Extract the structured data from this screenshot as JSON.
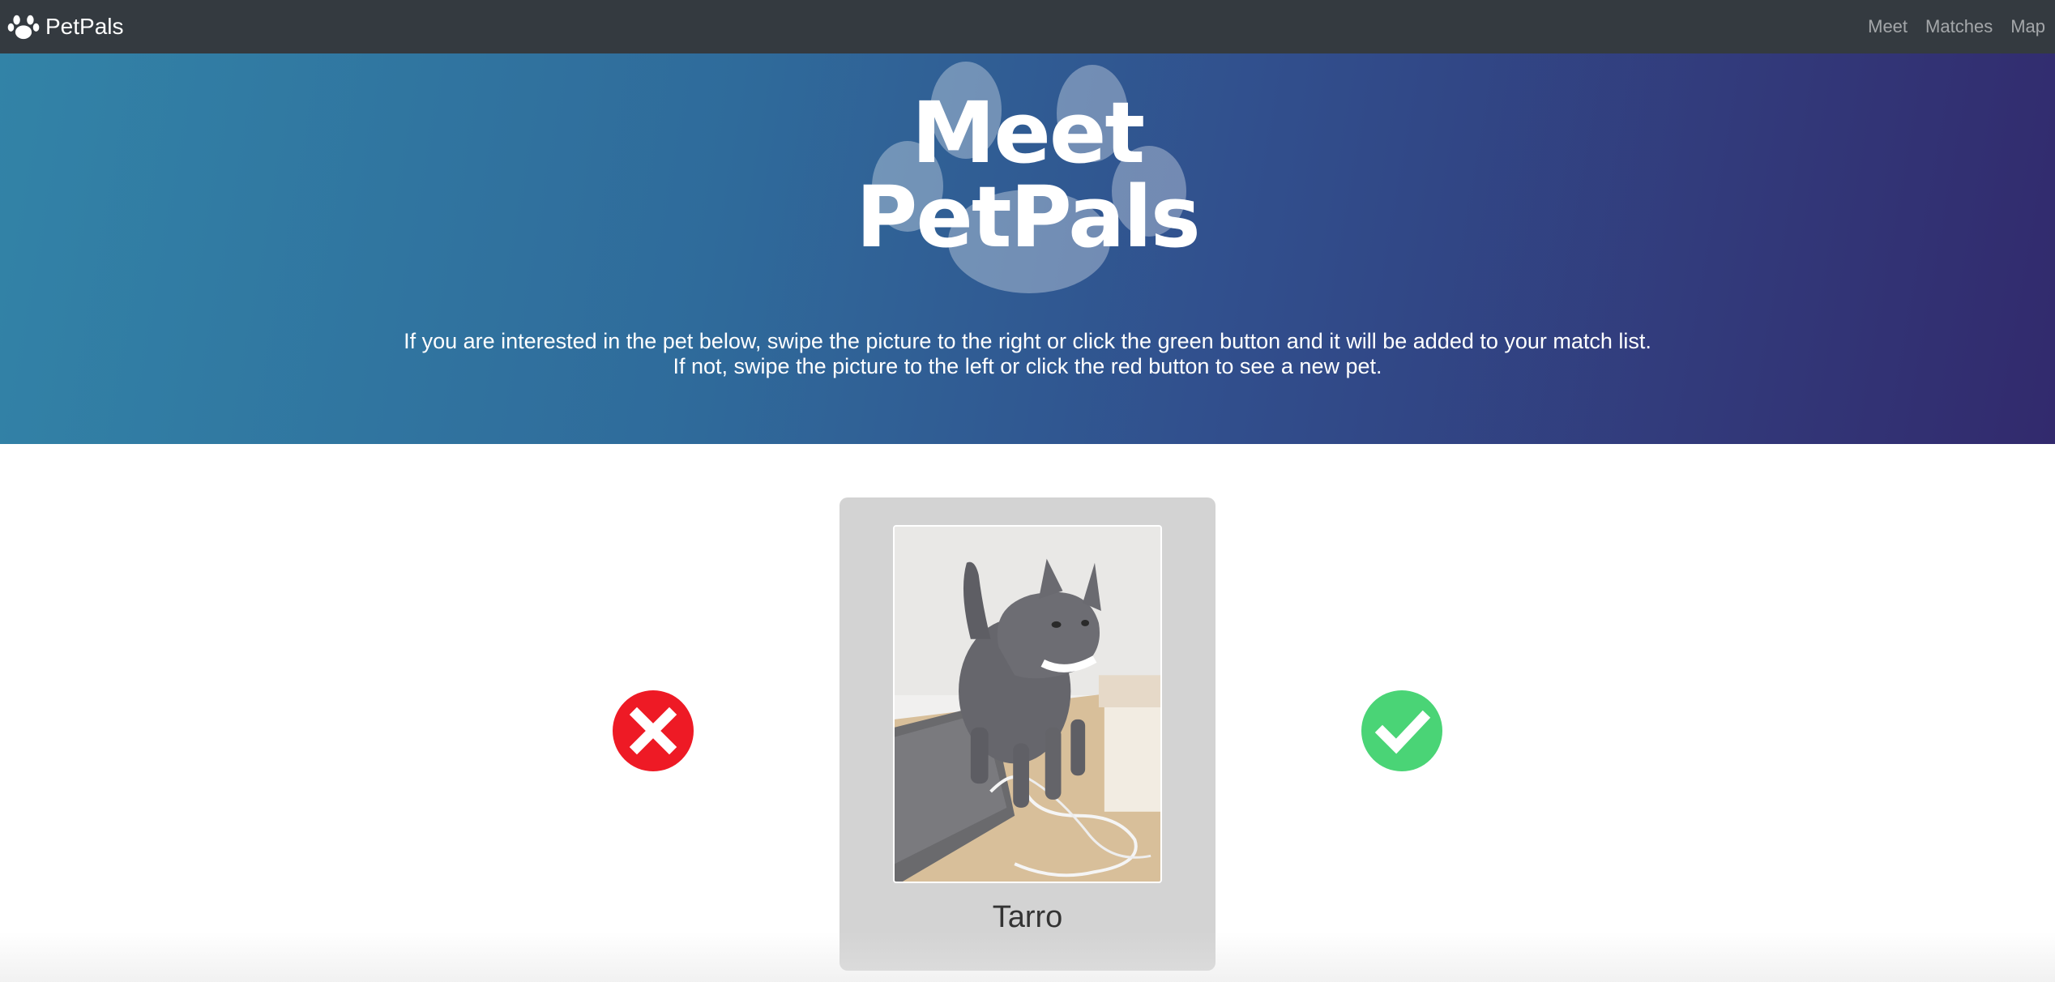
{
  "navbar": {
    "brand_name": "PetPals",
    "brand_icon": "paw-icon",
    "links": [
      {
        "label": "Meet"
      },
      {
        "label": "Matches"
      },
      {
        "label": "Map"
      }
    ]
  },
  "hero": {
    "title_line1": "Meet",
    "title_line2": "PetPals",
    "instruction_line1": "If you are interested in the pet below, swipe the picture to the right or click the green button and it will be added to your match list.",
    "instruction_line2": "If not, swipe the picture to the left or click the red button to see a new pet."
  },
  "actions": {
    "reject_icon": "x-icon",
    "reject_color": "#ee1a25",
    "accept_icon": "check-icon",
    "accept_color": "#4ad476"
  },
  "pet": {
    "name": "Tarro",
    "photo_subject": "gray kitten"
  },
  "colors": {
    "navbar": "#343a40",
    "hero_start": "#3283a7",
    "hero_end": "#322a6d",
    "card": "#d3d3d3"
  }
}
